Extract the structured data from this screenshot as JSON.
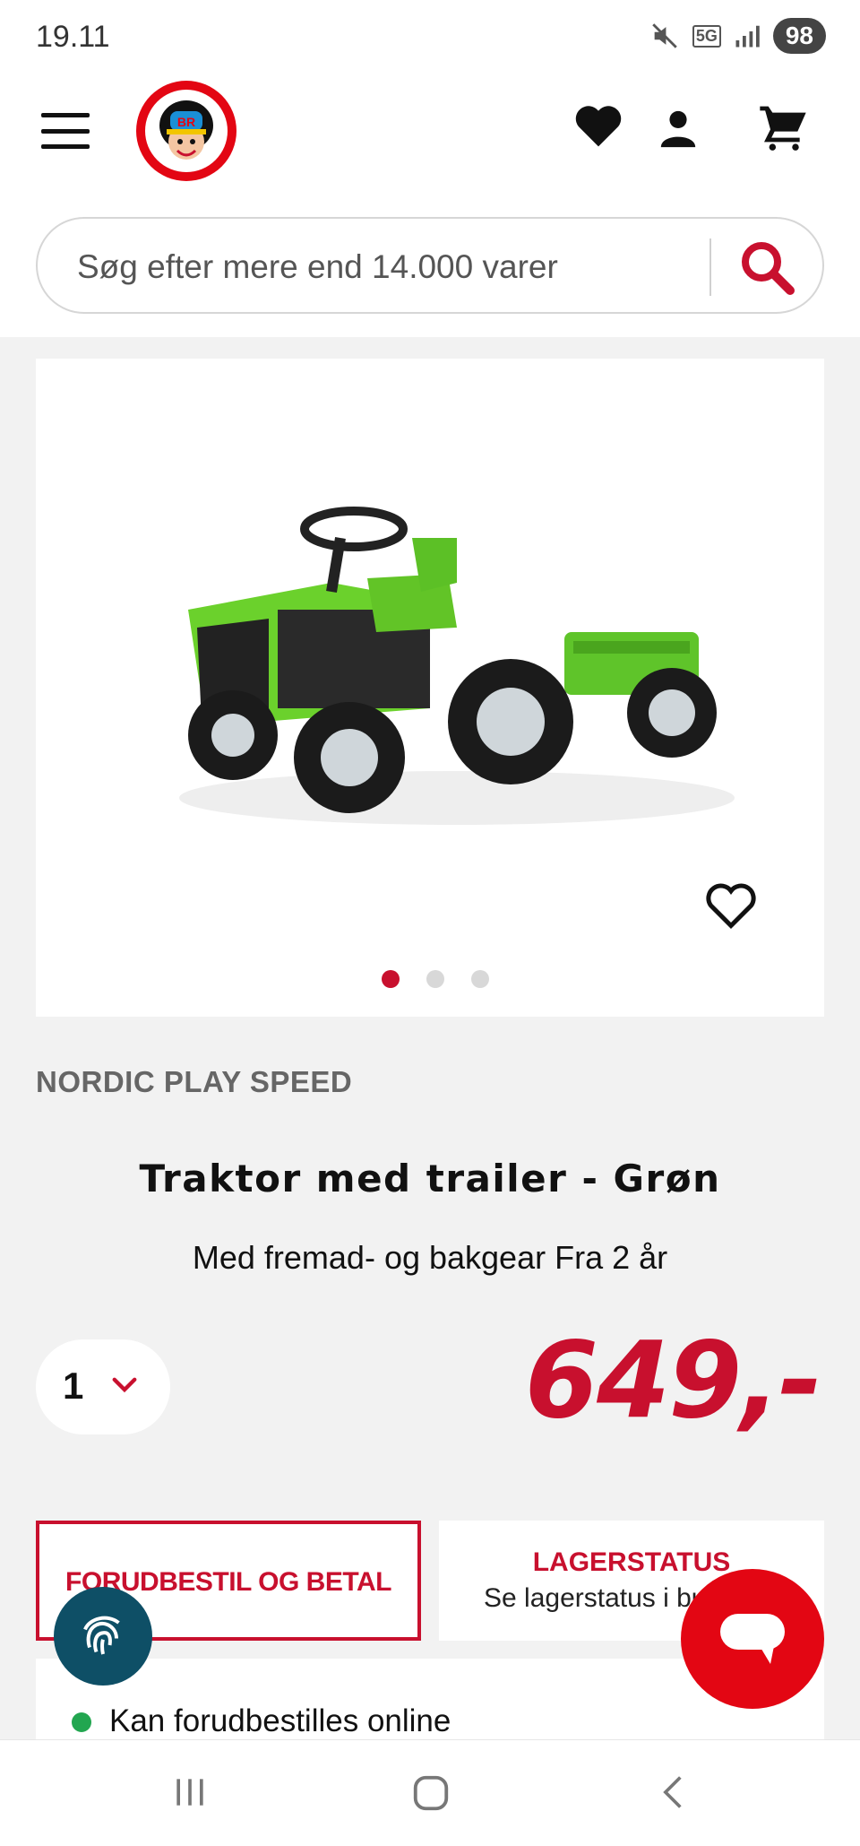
{
  "status_bar": {
    "time": "19.11",
    "network": "5G",
    "battery": "98"
  },
  "header": {
    "menu_icon": "hamburger-menu-icon",
    "logo_text": "BR",
    "icons": [
      "heart-icon",
      "user-icon",
      "cart-icon"
    ],
    "search": {
      "placeholder": "Søg efter mere end 14.000 varer",
      "icon": "search-icon"
    }
  },
  "product": {
    "image_count": 3,
    "active_image": 1,
    "brand": "NORDIC PLAY SPEED",
    "title": "Traktor med trailer - Grøn",
    "subtitle": "Med fremad- og bakgear Fra 2 år",
    "quantity": "1",
    "price": "649,-"
  },
  "actions": {
    "preorder_label": "FORUDBESTIL OG BETAL",
    "stock_title": "LAGERSTATUS",
    "stock_subtitle": "Se lagerstatus i butik",
    "availability": "Kan forudbestilles online"
  },
  "colors": {
    "accent": "#c8102e",
    "brand_red": "#e30613",
    "fingerprint_bg": "#0e4f66",
    "available": "#22a650"
  }
}
